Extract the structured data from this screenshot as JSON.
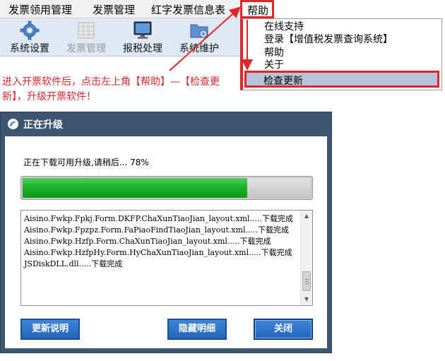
{
  "menubar": {
    "items": [
      "发票领用管理",
      "发票管理",
      "红字发票信息表"
    ],
    "help": "帮助"
  },
  "toolbar": {
    "items": [
      {
        "label": "系统设置",
        "icon": "gear-icon",
        "enabled": true
      },
      {
        "label": "发票管理",
        "icon": "grid-icon",
        "enabled": false
      },
      {
        "label": "报税处理",
        "icon": "monitor-icon",
        "enabled": true
      },
      {
        "label": "系统维护",
        "icon": "folder-gear-icon",
        "enabled": true
      }
    ]
  },
  "help_menu": {
    "items": [
      "在线支持",
      "登录【增值税发票查询系统】",
      "帮助",
      "关于"
    ],
    "selected": "检查更新"
  },
  "instruction": "进入开票软件后，点击左上角【帮助】—【检查更新】，升级开票软件！",
  "dialog": {
    "title": "正在升级",
    "status": "正在下载可用升级,请稍后... 78%",
    "progress": 0.78,
    "log_lines": [
      "Aisino.Fwkp.Fpkj.Form.DKFP.ChaXunTiaoJian_layout.xml.....下载完成",
      "Aisino.Fwkp.Fpzpz.Form.FaPiaoFindTiaoJian_layout.xml.....下载完成",
      "Aisino.Fwkp.Hzfp.Form.ChaXunTiaoJian_layout.xml.....下载完成",
      "Aisino.Fwkp.HzfpHy.Form.HyChaXunTiaoJian_layout.xml.....下载完成",
      "JSDiskDLL.dll.....下载完成"
    ],
    "buttons": {
      "notes": "更新说明",
      "hide": "隐藏明细",
      "close": "关闭"
    }
  },
  "colors": {
    "highlight_red": "#e0262b",
    "dialog_frame": "#3d556f",
    "button_blue": "#2465b8",
    "progress_green": "#1fb02a"
  }
}
